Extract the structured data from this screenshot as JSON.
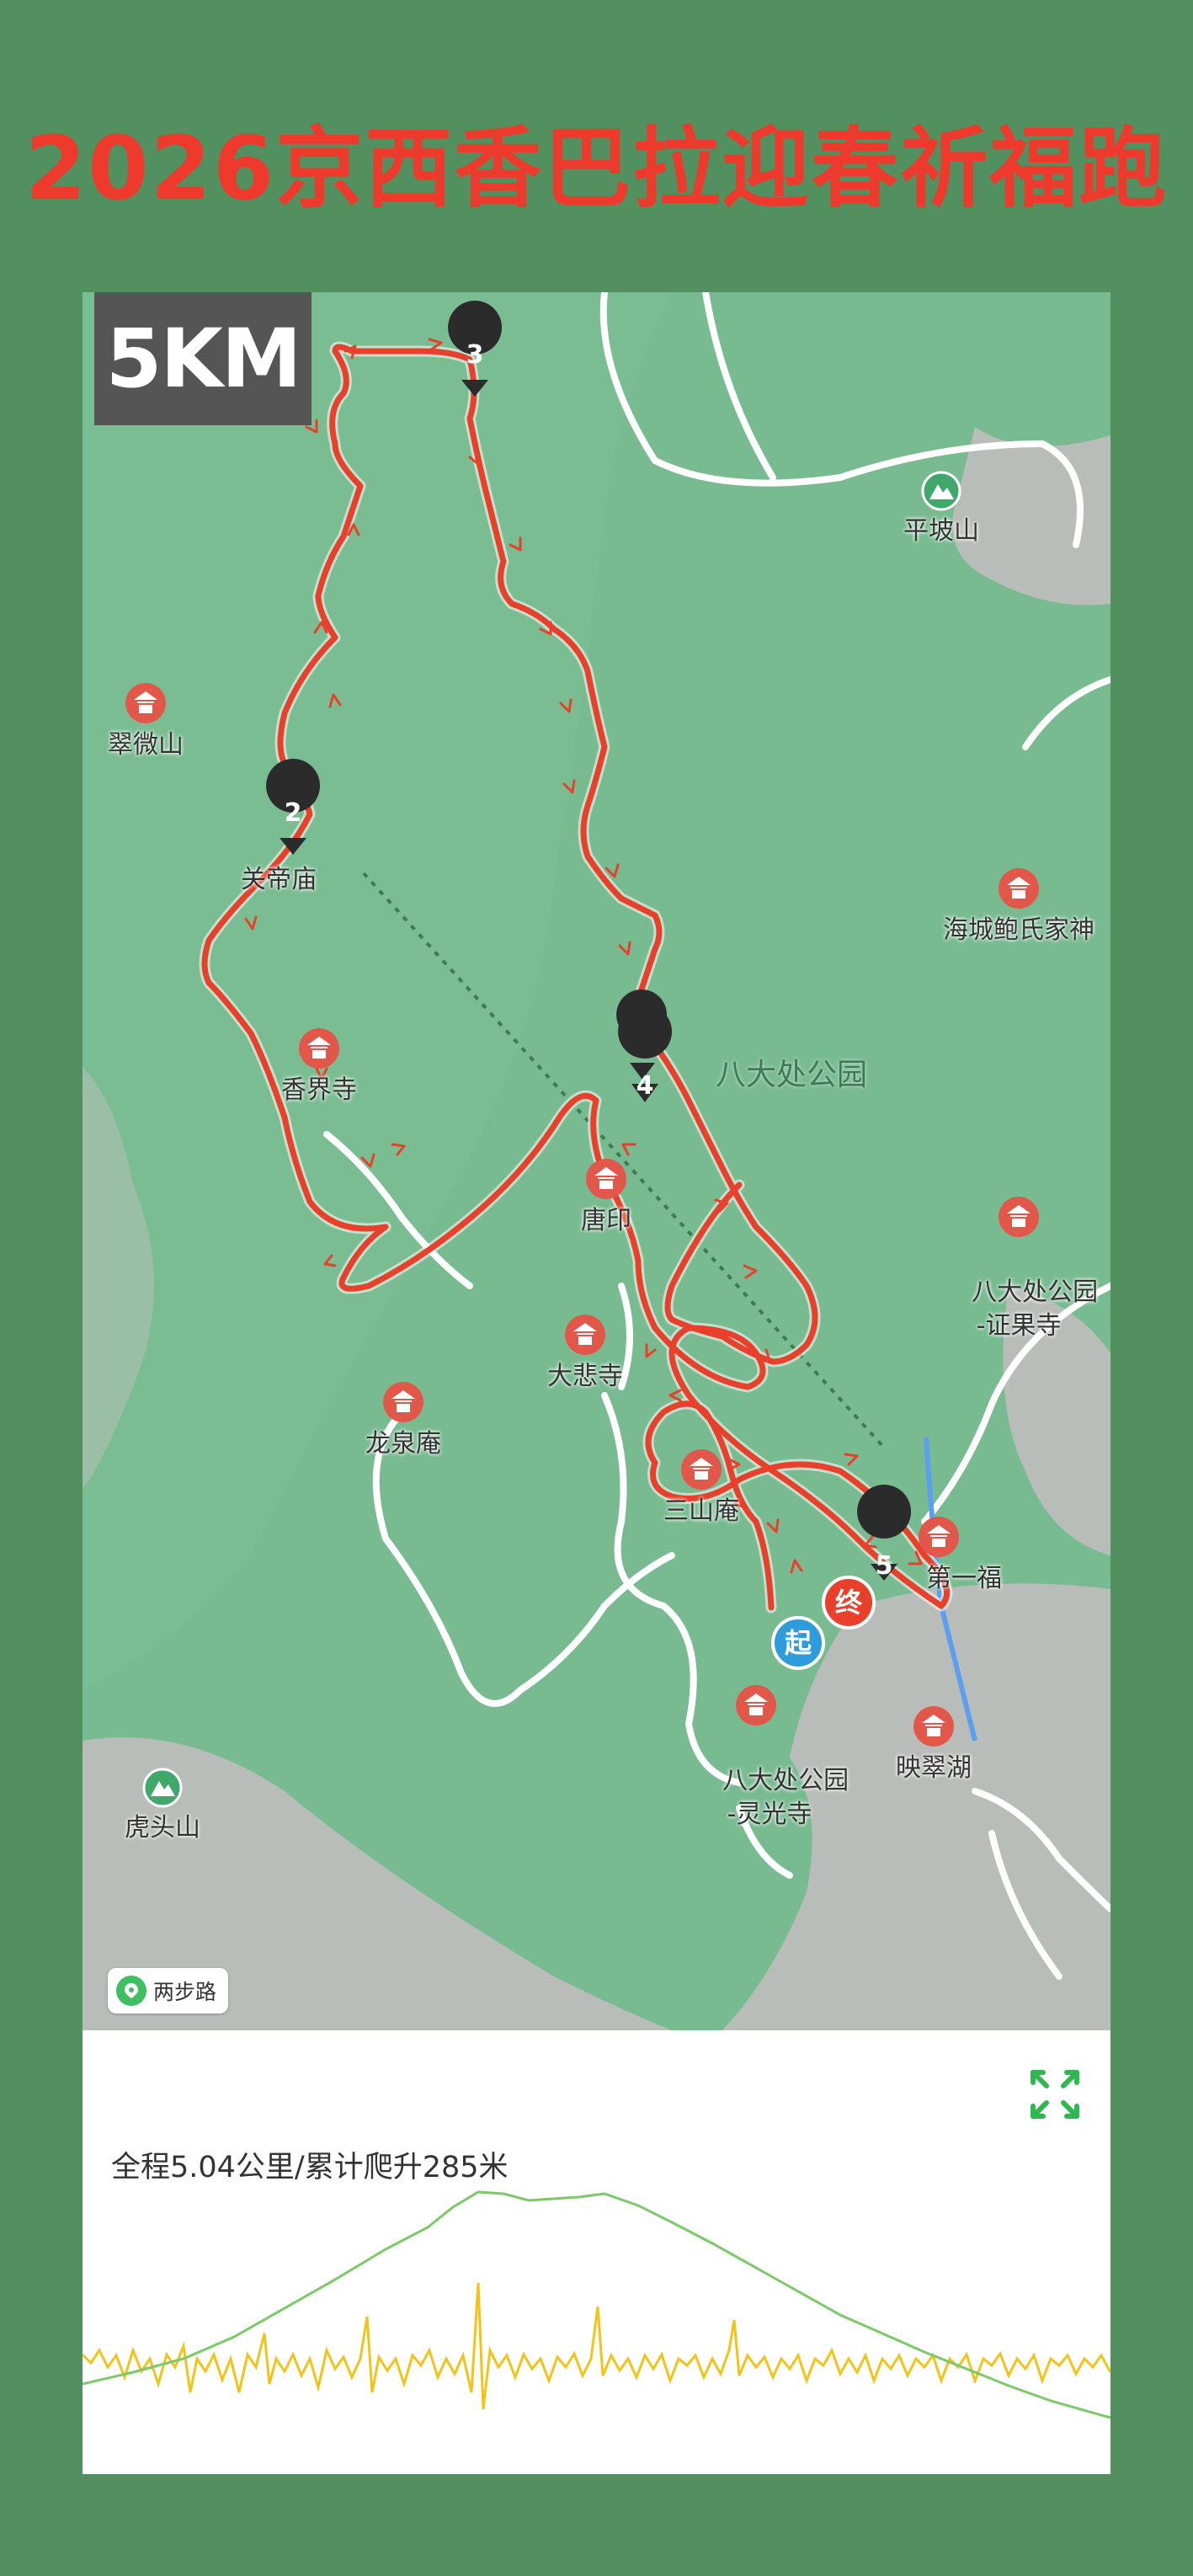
{
  "title": "2026京西香巴拉迎春祈福跑",
  "distance_badge": "5KM",
  "map": {
    "area_label": "八大处公园",
    "pois": [
      {
        "id": "pingposhan",
        "name": "平坡山",
        "icon": "mountain-icon"
      },
      {
        "id": "cuiweishan",
        "name": "翠微山",
        "icon": "temple-icon"
      },
      {
        "id": "guandimiao",
        "name": "关帝庙",
        "icon": "temple-icon"
      },
      {
        "id": "xiangjiesi",
        "name": "香界寺",
        "icon": "temple-icon"
      },
      {
        "id": "haicheng",
        "name": "海城鲍氏家神",
        "icon": "temple-icon"
      },
      {
        "id": "zhengguosi",
        "name": "八大处公园\n-证果寺",
        "icon": "temple-icon"
      },
      {
        "id": "tangyin",
        "name": "唐印",
        "icon": "temple-icon"
      },
      {
        "id": "dabeisi",
        "name": "大悲寺",
        "icon": "temple-icon"
      },
      {
        "id": "longquanan",
        "name": "龙泉庵",
        "icon": "temple-icon"
      },
      {
        "id": "sanshanan",
        "name": "三山庵",
        "icon": "temple-icon"
      },
      {
        "id": "diyifu",
        "name": "第一福",
        "icon": "temple-icon"
      },
      {
        "id": "lingguangsi",
        "name": "八大处公园\n-灵光寺",
        "icon": "temple-icon"
      },
      {
        "id": "yingcuihu",
        "name": "映翠湖",
        "icon": "temple-icon"
      },
      {
        "id": "hutoushan",
        "name": "虎头山",
        "icon": "mountain-icon"
      }
    ],
    "markers": {
      "start": "起",
      "end": "终",
      "km": [
        "1",
        "2",
        "3",
        "4",
        "5"
      ]
    },
    "route_color": "#e8402a",
    "watermark": "两步路"
  },
  "elevation_panel": {
    "summary": "全程5.04公里/累计爬升285米",
    "elevation_color": "#7cc96a",
    "speed_color": "#f2c419"
  }
}
